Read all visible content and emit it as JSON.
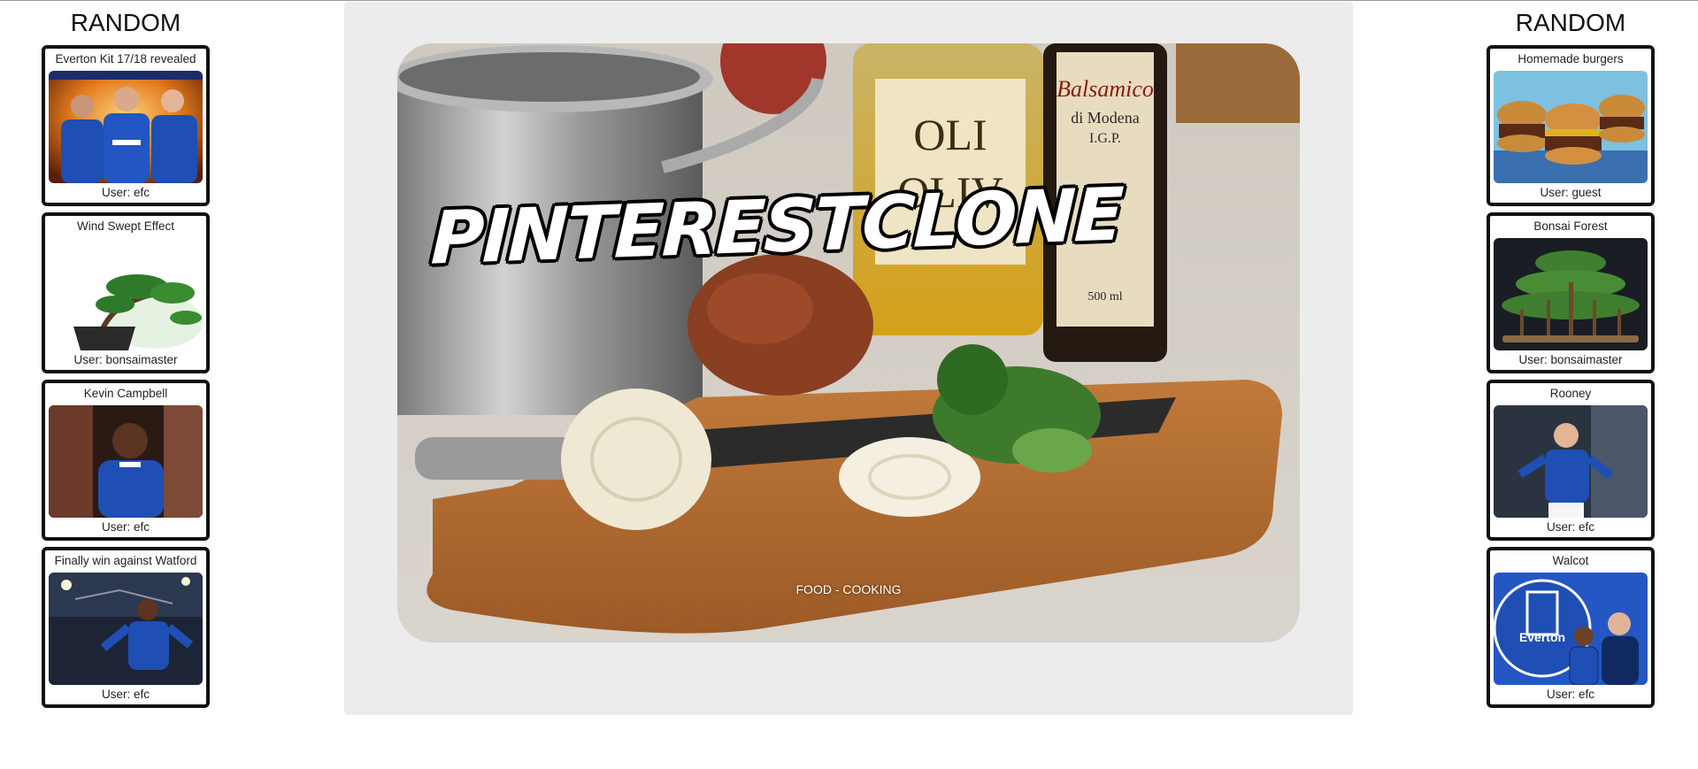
{
  "left_column": {
    "title": "RANDOM",
    "cards": [
      {
        "title": "Everton Kit 17/18 revealed",
        "user": "User: efc",
        "image": "everton-players-image"
      },
      {
        "title": "Wind Swept Effect",
        "user": "User: bonsaimaster",
        "image": "bonsai-tree-image"
      },
      {
        "title": "Kevin Campbell",
        "user": "User: efc",
        "image": "footballer-portrait-image"
      },
      {
        "title": "Finally win against Watford",
        "user": "User: efc",
        "image": "footballer-celebrating-image"
      }
    ]
  },
  "right_column": {
    "title": "RANDOM",
    "cards": [
      {
        "title": "Homemade burgers",
        "user": "User: guest",
        "image": "burgers-image"
      },
      {
        "title": "Bonsai Forest",
        "user": "User: bonsaimaster",
        "image": "bonsai-forest-image"
      },
      {
        "title": "Rooney",
        "user": "User: efc",
        "image": "rooney-image"
      },
      {
        "title": "Walcot",
        "user": "User: efc",
        "image": "everton-crest-players-image"
      }
    ]
  },
  "hero": {
    "logo": "PINTERESTCLONE",
    "caption": "FOOD - COOKING",
    "image": "cooking-ingredients-image"
  },
  "colors": {
    "panel_bg": "#ececec",
    "card_border": "#111111",
    "everton_blue": "#1f4fb4"
  }
}
